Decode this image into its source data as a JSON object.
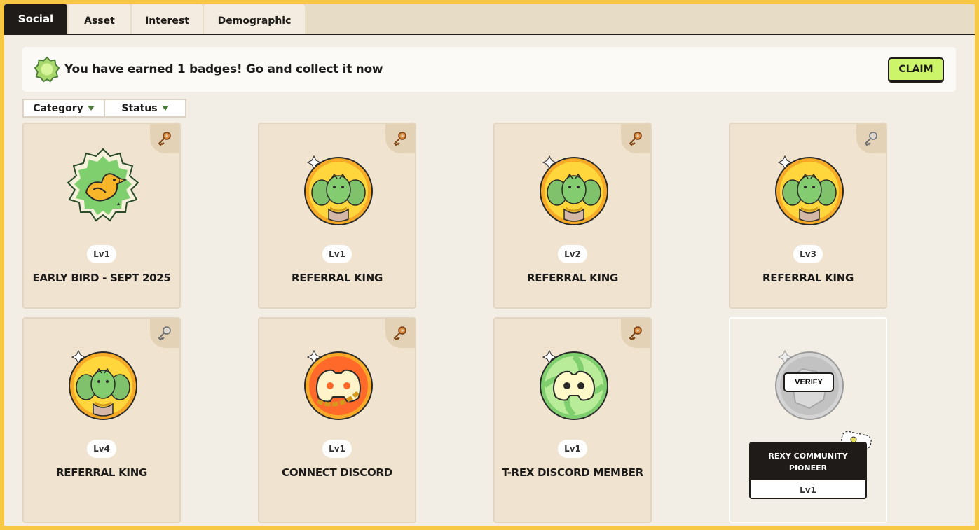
{
  "tabs": [
    {
      "label": "Social",
      "active": true
    },
    {
      "label": "Asset",
      "active": false
    },
    {
      "label": "Interest",
      "active": false
    },
    {
      "label": "Demographic",
      "active": false
    }
  ],
  "banner": {
    "icon": "badge-star-icon",
    "text": "You have earned 1 badges! Go and collect it now",
    "claim_label": "CLAIM"
  },
  "filters": {
    "category_label": "Category",
    "status_label": "Status"
  },
  "badges": [
    {
      "title": "EARLY BIRD - SEPT 2025",
      "level": "Lv1",
      "icon": "bird-badge-icon",
      "key": "bronze-key-icon"
    },
    {
      "title": "REFERRAL KING",
      "level": "Lv1",
      "icon": "dino-trio-badge-icon",
      "key": "bronze-key-icon"
    },
    {
      "title": "REFERRAL KING",
      "level": "Lv2",
      "icon": "dino-trio-badge-icon",
      "key": "bronze-key-icon"
    },
    {
      "title": "REFERRAL KING",
      "level": "Lv3",
      "icon": "dino-trio-badge-icon",
      "key": "silver-key-icon"
    },
    {
      "title": "REFERRAL KING",
      "level": "Lv4",
      "icon": "dino-trio-badge-icon",
      "key": "silver-key-icon"
    },
    {
      "title": "CONNECT DISCORD",
      "level": "Lv1",
      "icon": "discord-chain-badge-icon",
      "key": "bronze-key-icon"
    },
    {
      "title": "T-REX DISCORD MEMBER",
      "level": "Lv1",
      "icon": "discord-swirl-badge-icon",
      "key": "bronze-key-icon"
    },
    {
      "title": "REXY COMMUNITY PIONEER",
      "level": "Lv1",
      "icon": "locked-badge-icon",
      "verify_label": "VERIFY"
    }
  ],
  "colors": {
    "frame": "#f7c843",
    "dark": "#1f1b18",
    "claim": "#ccf56a",
    "card": "#f0e4d1"
  }
}
